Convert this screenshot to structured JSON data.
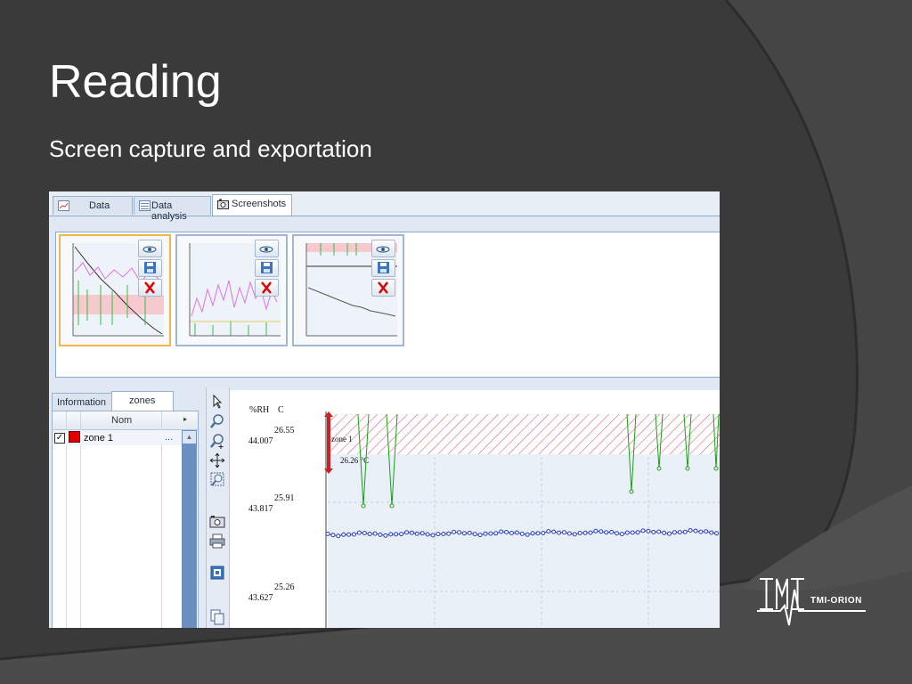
{
  "slide": {
    "title": "Reading",
    "subtitle": "Screen capture and exportation"
  },
  "app": {
    "tabs": [
      {
        "label": "Data",
        "icon": "data-icon"
      },
      {
        "label": "Data analysis",
        "icon": "analysis-icon"
      },
      {
        "label": "Screenshots",
        "icon": "camera-icon",
        "active": true
      }
    ],
    "screenshots": [
      {
        "selected": true,
        "buttons": [
          "view-eye-icon",
          "save-icon",
          "delete-icon"
        ]
      },
      {
        "selected": false,
        "buttons": [
          "view-eye-icon",
          "save-icon",
          "delete-icon"
        ]
      },
      {
        "selected": false,
        "buttons": [
          "view-eye-icon",
          "save-icon",
          "delete-icon"
        ]
      }
    ],
    "lower_tabs": [
      {
        "label": "Information"
      },
      {
        "label": "zones",
        "active": true
      }
    ],
    "zones_grid": {
      "header": "Nom",
      "rows": [
        {
          "checked": true,
          "color": "#e00000",
          "name": "zone 1",
          "more": "..."
        }
      ]
    },
    "tools": [
      "pointer-icon",
      "zoom-icon",
      "zoom-in-icon",
      "pan-icon",
      "zoom-box-icon",
      "screenshot-icon",
      "print-icon",
      "fit-icon",
      "copy-icon"
    ],
    "chart": {
      "units": {
        "rh": "%RH",
        "temp": "C"
      },
      "ticks": [
        {
          "temp": "26.55",
          "rh": "44.007"
        },
        {
          "temp": "25.91",
          "rh": "43.817"
        },
        {
          "temp": "25.26",
          "rh": "43.627"
        }
      ],
      "zone_label": "zone 1",
      "zone_value": "26.26 °C",
      "zone_color": "#e03030",
      "spike_color": "#1aa01a",
      "series_color": "#2a3fc0"
    }
  },
  "brand": {
    "name": "TMI-ORION"
  },
  "colors": {
    "background": "#3a3a3a",
    "accent_arc": "#4a4a4a"
  }
}
